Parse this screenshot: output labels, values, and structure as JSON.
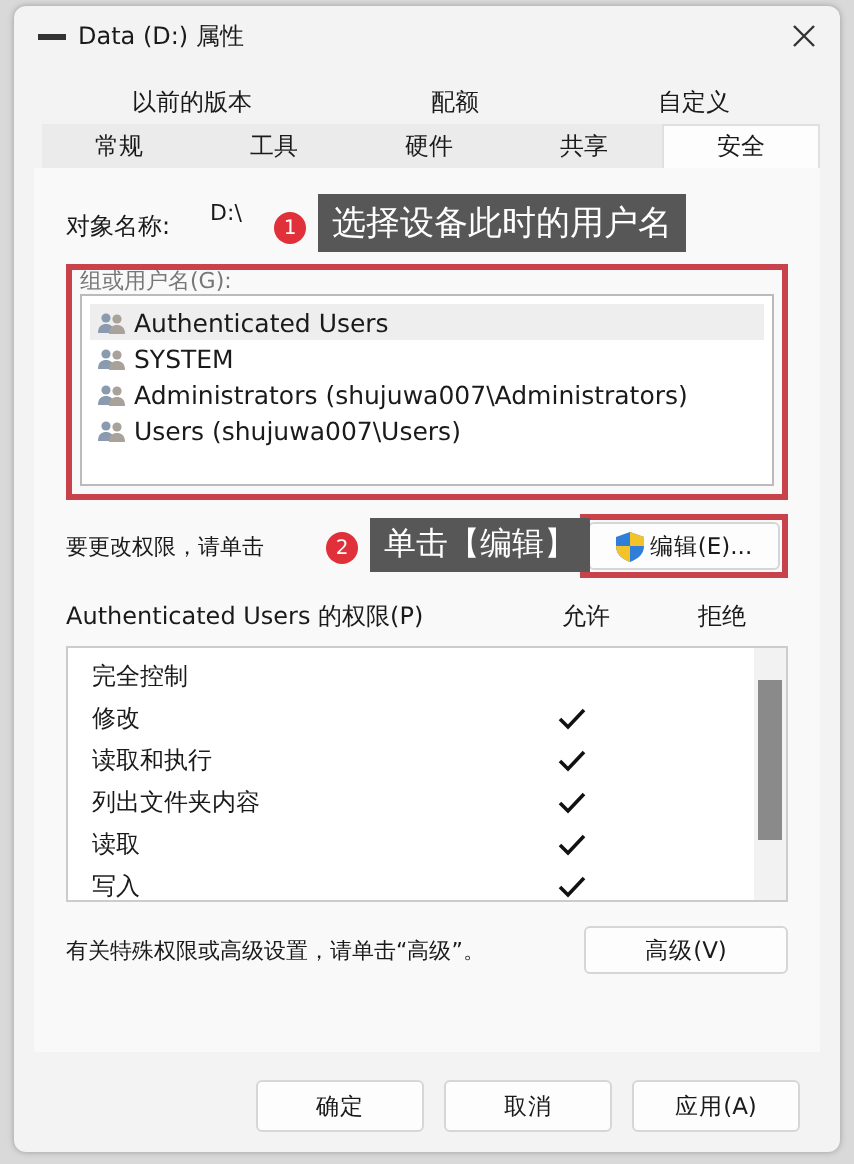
{
  "window": {
    "title": "Data (D:) 属性"
  },
  "tab_rows": [
    [
      {
        "label": "以前的版本",
        "selected": false
      },
      {
        "label": "配额",
        "selected": false
      },
      {
        "label": "自定义",
        "selected": false
      }
    ],
    [
      {
        "label": "常规",
        "selected": false
      },
      {
        "label": "工具",
        "selected": false
      },
      {
        "label": "硬件",
        "selected": false
      },
      {
        "label": "共享",
        "selected": false
      },
      {
        "label": "安全",
        "selected": true
      }
    ]
  ],
  "object_name": {
    "label": "对象名称:",
    "value": "D:\\",
    "callout": {
      "number": "1",
      "text": "选择设备此时的用户名"
    }
  },
  "groups": {
    "label": "组或用户名(G):",
    "highlighted": true,
    "items": [
      {
        "name": "Authenticated Users",
        "selected": true
      },
      {
        "name": "SYSTEM",
        "selected": false
      },
      {
        "name": "Administrators (shujuwa007\\Administrators)",
        "selected": false
      },
      {
        "name": "Users (shujuwa007\\Users)",
        "selected": false
      }
    ]
  },
  "edit": {
    "hint": "要更改权限，请单击",
    "callout": {
      "number": "2",
      "text": "单击【编辑】"
    },
    "button": "编辑(E)...",
    "highlighted": true
  },
  "permissions": {
    "title": "Authenticated Users 的权限(P)",
    "allow_header": "允许",
    "deny_header": "拒绝",
    "rows": [
      {
        "name": "完全控制",
        "allow": false,
        "deny": false
      },
      {
        "name": "修改",
        "allow": true,
        "deny": false
      },
      {
        "name": "读取和执行",
        "allow": true,
        "deny": false
      },
      {
        "name": "列出文件夹内容",
        "allow": true,
        "deny": false
      },
      {
        "name": "读取",
        "allow": true,
        "deny": false
      },
      {
        "name": "写入",
        "allow": true,
        "deny": false
      }
    ]
  },
  "advanced": {
    "hint": "有关特殊权限或高级设置，请单击“高级”。",
    "button": "高级(V)"
  },
  "buttons": [
    "确定",
    "取消",
    "应用(A)"
  ]
}
